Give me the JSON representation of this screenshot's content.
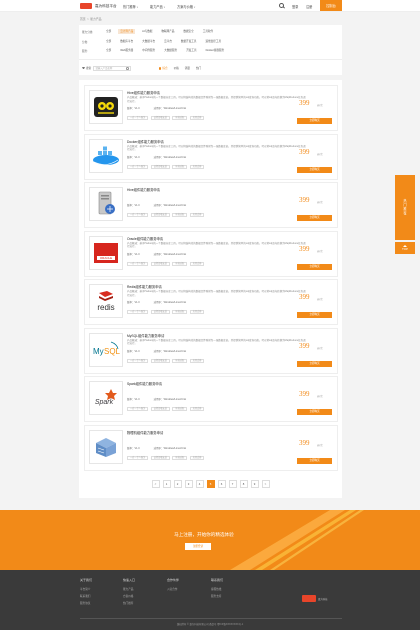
{
  "header": {
    "logo_text": "嘉为科技平台",
    "nav": [
      {
        "label": "热门推荐",
        "caret": "▾"
      },
      {
        "label": "能力产品",
        "caret": "▾"
      },
      {
        "label": "方案与价格",
        "caret": "▾"
      }
    ],
    "login_label": "登录",
    "register_label": "注册",
    "console_label": "控制台"
  },
  "breadcrumb": [
    "首页",
    ">",
    "能力产品"
  ],
  "filters": {
    "rows": [
      {
        "label": "能力分类:",
        "options": [
          "全部",
          "云计算产品",
          "AI与数据",
          "物联网产品",
          "数据安全",
          "工具软件"
        ],
        "active": 1
      },
      {
        "label": "分类:",
        "options": [
          "全部",
          "数据库平台",
          "大数据平台",
          "云平台",
          "数据开发工具",
          "运维监控工具"
        ],
        "active": 0
      },
      {
        "label": "服务:",
        "options": [
          "全部",
          "Web服务器",
          "中间件服务",
          "大数据服务",
          "开发工具",
          "Docker容器服务"
        ],
        "active": 0
      }
    ],
    "search_label": "搜索",
    "search_placeholder": "请输入产品名称",
    "sort": [
      {
        "label": "综合",
        "active": true
      },
      {
        "label": "价格",
        "active": false
      },
      {
        "label": "销量",
        "active": false
      },
      {
        "label": "热门",
        "active": false
      }
    ]
  },
  "products": [
    {
      "title": "Hive组件能力服务申请",
      "logo": "hive",
      "desc": "产品概述：基于Hadoop的一个数据仓库工具，可以将结构化的数据文件映射为一张数据库表，并提供简单的sql查询功能，可以将sql语句转换为MapReduce任务进行运行。",
      "version_label": "版本：V1.0",
      "os_label": "适用于：Windows/Linux/Unix",
      "tags": [
        "一对一专人服务",
        "远程部署安装",
        "环境适配",
        "应用迁移"
      ],
      "price": "399",
      "unit": "元/次",
      "buy_label": "立即购买"
    },
    {
      "title": "Docker组件能力服务申请",
      "logo": "docker",
      "desc": "产品概述：基于Hadoop的一个数据仓库工具，可以将结构化的数据文件映射为一张数据库表，并提供简单的sql查询功能，可以将sql语句转换为MapReduce任务进行运行。",
      "version_label": "版本：V1.0",
      "os_label": "适用于：Windows/Linux/Unix",
      "tags": [
        "一对一专人服务",
        "远程部署安装",
        "环境适配",
        "应用迁移"
      ],
      "price": "399",
      "unit": "元/次",
      "buy_label": "立即购买"
    },
    {
      "title": "Hive组件能力服务申请",
      "logo": "server",
      "desc": "",
      "version_label": "版本：V1.0",
      "os_label": "适用于：Windows/Linux/Unix",
      "tags": [
        "一对一专人服务",
        "远程部署安装",
        "环境适配",
        "应用迁移"
      ],
      "price": "399",
      "unit": "元/次",
      "buy_label": "立即购买"
    },
    {
      "title": "Oracle组件能力服务申请",
      "logo": "oracle",
      "desc": "产品概述：基于Hadoop的一个数据仓库工具，可以将结构化的数据文件映射为一张数据库表，并提供简单的sql查询功能，可以将sql语句转换为MapReduce任务进行运行。",
      "version_label": "版本：V1.0",
      "os_label": "适用于：Windows/Linux/Unix",
      "tags": [
        "一对一专人服务",
        "远程部署安装",
        "环境适配",
        "应用迁移"
      ],
      "price": "399",
      "unit": "元/次",
      "buy_label": "立即购买"
    },
    {
      "title": "Redis组件能力服务申请",
      "logo": "redis",
      "desc": "产品概述：基于Hadoop的一个数据仓库工具，可以将结构化的数据文件映射为一张数据库表，并提供简单的sql查询功能，可以将sql语句转换为MapReduce任务进行运行。",
      "version_label": "版本：V1.0",
      "os_label": "适用于：Windows/Linux/Unix",
      "tags": [
        "一对一专人服务",
        "远程部署安装",
        "环境适配",
        "应用迁移"
      ],
      "price": "399",
      "unit": "元/次",
      "buy_label": "立即购买"
    },
    {
      "title": "MySQL组件能力服务申请",
      "logo": "mysql",
      "desc": "产品概述：基于Hadoop的一个数据仓库工具，可以将结构化的数据文件映射为一张数据库表，并提供简单的sql查询功能，可以将sql语句转换为MapReduce任务进行运行。",
      "version_label": "版本：V1.0",
      "os_label": "适用于：Windows/Linux/Unix",
      "tags": [
        "一对一专人服务",
        "远程部署安装",
        "环境适配",
        "应用迁移"
      ],
      "price": "399",
      "unit": "元/次",
      "buy_label": "立即购买"
    },
    {
      "title": "Spark组件能力服务申请",
      "logo": "spark",
      "desc": "",
      "version_label": "版本：V1.0",
      "os_label": "适用于：Windows/Linux/Unix",
      "tags": [
        "一对一专人服务",
        "远程部署安装",
        "环境适配",
        "应用迁移"
      ],
      "price": "399",
      "unit": "元/次",
      "buy_label": "立即购买"
    },
    {
      "title": "物理机组件能力服务申请",
      "logo": "storage",
      "desc": "",
      "version_label": "版本：V1.0",
      "os_label": "适用于：Windows/Linux/Unix",
      "tags": [
        "一对一专人服务",
        "远程部署安装",
        "环境适配",
        "应用迁移"
      ],
      "price": "399",
      "unit": "元/次",
      "buy_label": "立即购买"
    }
  ],
  "pagination": {
    "pages": [
      "<",
      "1",
      "2",
      "3",
      "4",
      "5",
      "6",
      "7",
      "8",
      "9",
      ">"
    ],
    "active": "5"
  },
  "side": {
    "hot_label": "热门推荐",
    "top_label": "TOP"
  },
  "banner": {
    "text": "马上注册，开始你的精选体验",
    "button_label": "注册登录"
  },
  "footer": {
    "columns": [
      {
        "heading": "关于我们",
        "items": [
          "平台简介",
          "联系我们",
          "服务协议"
        ]
      },
      {
        "heading": "快速入口",
        "items": [
          "能力产品",
          "方案价格",
          "热门推荐"
        ]
      },
      {
        "heading": "合作伙伴",
        "items": [
          "入驻合作"
        ]
      },
      {
        "heading": "联系我们",
        "items": [
          "客服热线",
          "服务支持"
        ]
      }
    ],
    "logo_text": "嘉为科技",
    "copyright": "版权所有 © 嘉为科技有限公司 备案号 粤ICP备XXXXXXXX号-1"
  },
  "colors": {
    "accent": "#f28a18",
    "brand_red": "#e8452a",
    "footer_bg": "#3a3a3a"
  }
}
